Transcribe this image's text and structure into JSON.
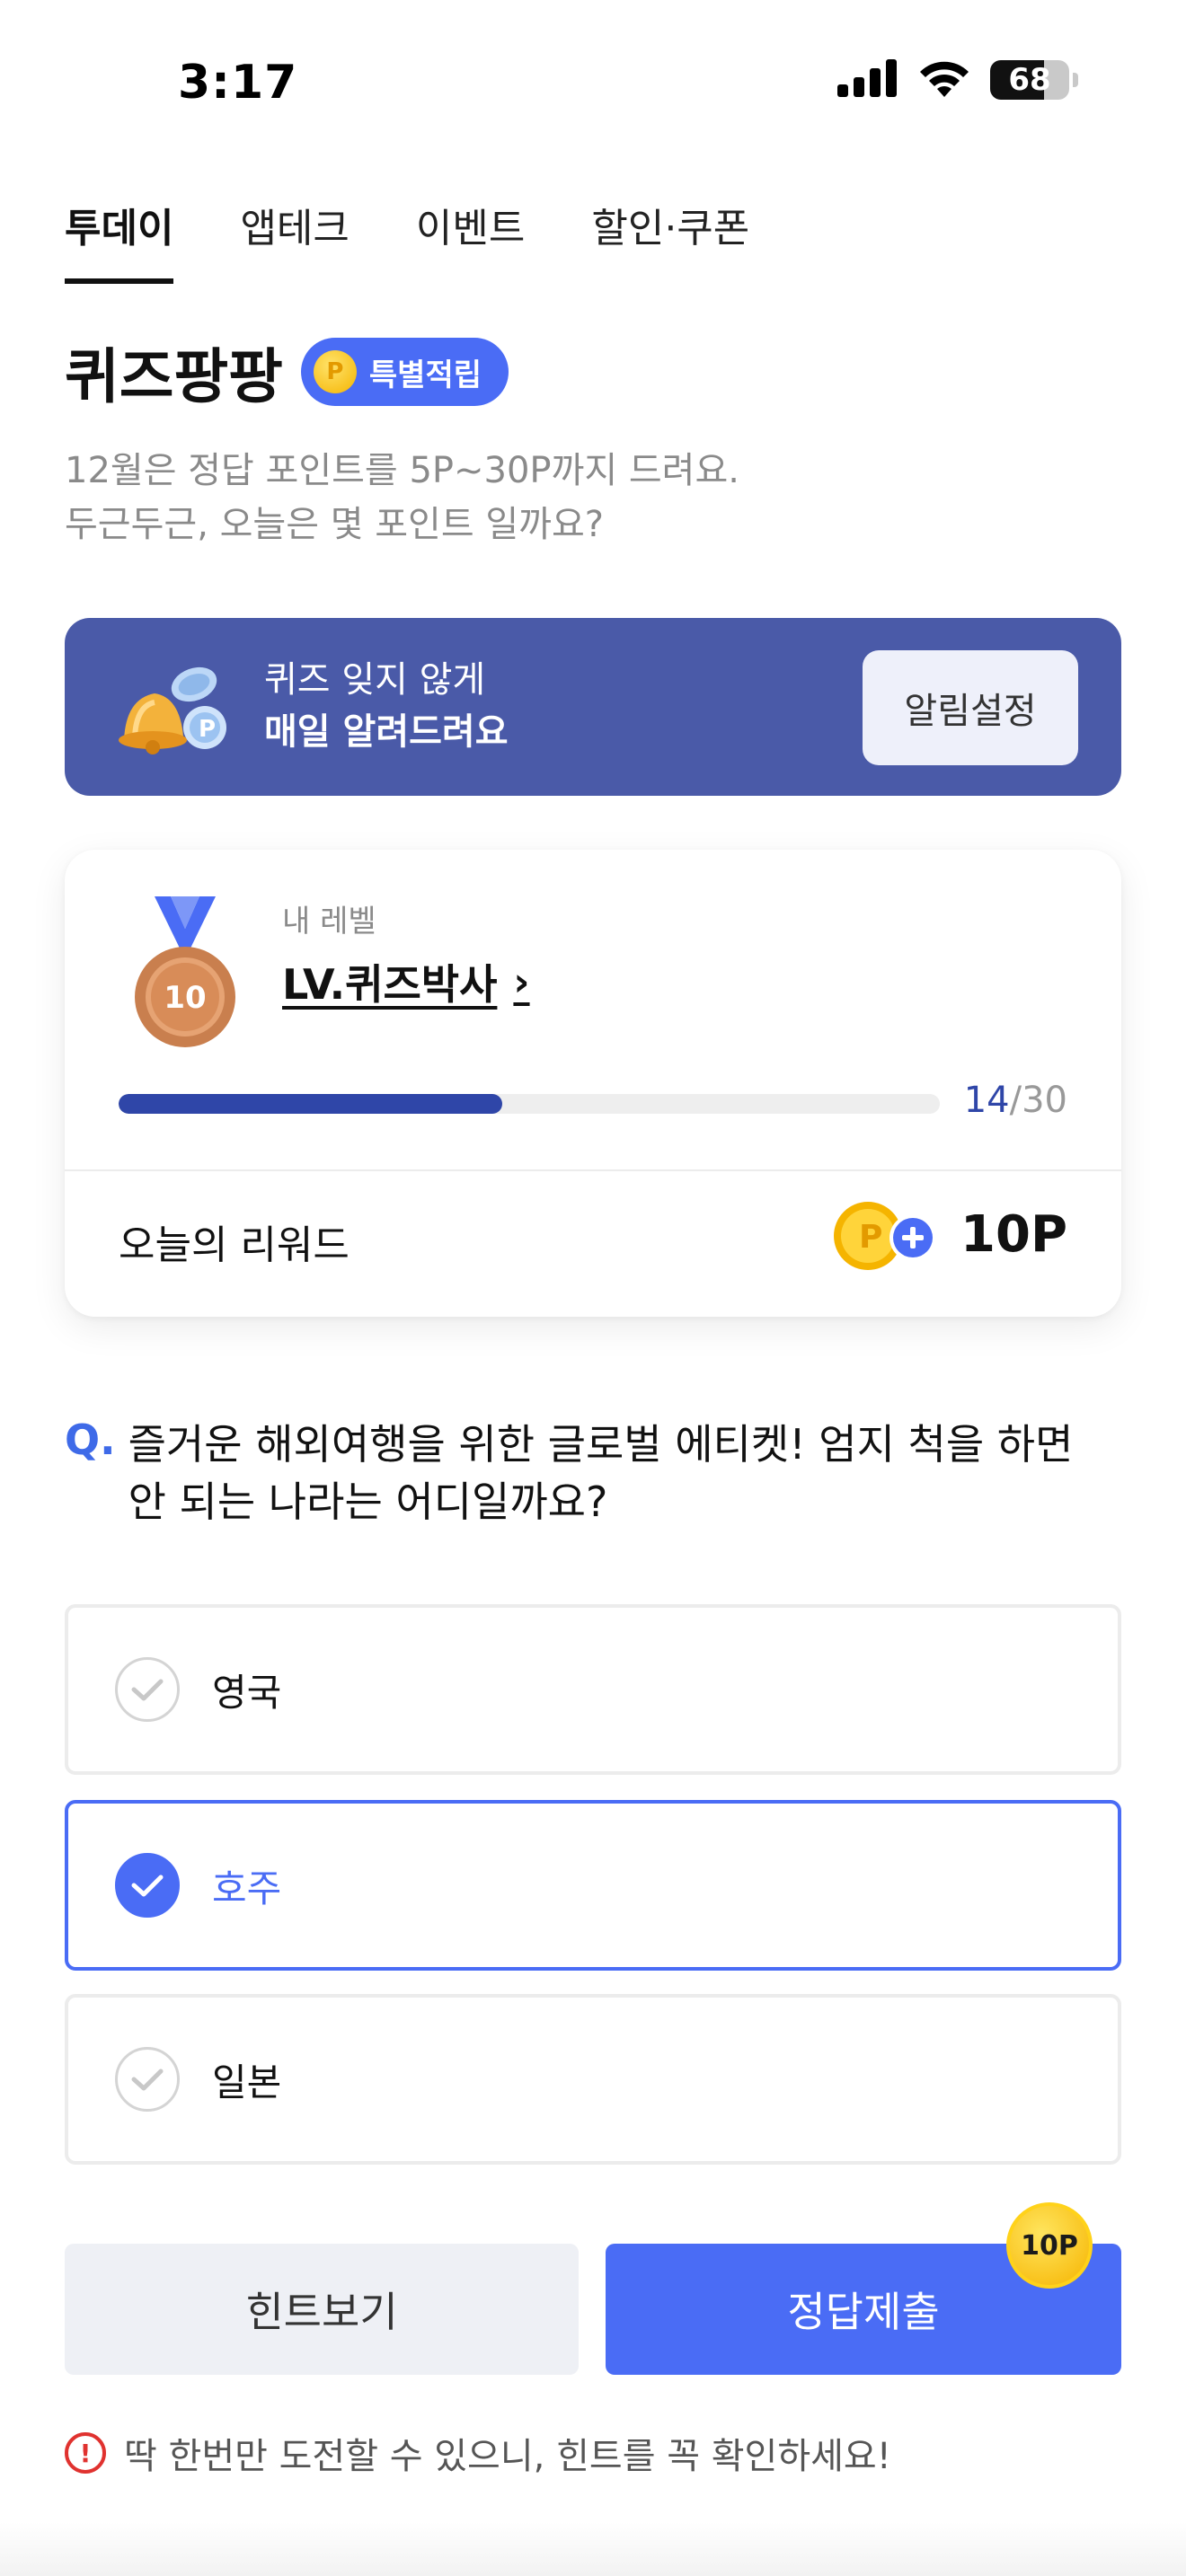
{
  "status_bar": {
    "time": "3:17",
    "battery": "68"
  },
  "tabs": [
    {
      "label": "투데이",
      "active": true
    },
    {
      "label": "앱테크",
      "active": false
    },
    {
      "label": "이벤트",
      "active": false
    },
    {
      "label": "할인·쿠폰",
      "active": false
    }
  ],
  "header": {
    "title": "퀴즈팡팡",
    "badge": "특별적립",
    "subtitle_line1": "12월은 정답 포인트를 5P~30P까지 드려요.",
    "subtitle_line2": "두근두근, 오늘은 몇 포인트 일까요?"
  },
  "notice": {
    "line1": "퀴즈 잊지 않게",
    "line2": "매일 알려드려요",
    "button": "알림설정"
  },
  "level": {
    "caption": "내 레벨",
    "name": "LV.퀴즈박사",
    "medal_number": "10",
    "progress_current": "14",
    "progress_total": "/30",
    "progress_fraction": 0.4667
  },
  "reward": {
    "label": "오늘의 리워드",
    "value": "10P"
  },
  "question": {
    "mark": "Q.",
    "text_line1": "즐거운 해외여행을 위한 글로벌 에티켓! 엄지 척을 하면",
    "text_line2": "안 되는 나라는 어디일까요?"
  },
  "options": [
    {
      "label": "영국",
      "selected": false
    },
    {
      "label": "호주",
      "selected": true
    },
    {
      "label": "일본",
      "selected": false
    }
  ],
  "buttons": {
    "hint": "힌트보기",
    "submit": "정답제출",
    "point_chip": "10P"
  },
  "warning": {
    "text": "딱 한번만 도전할 수 있으니, 힌트를 꼭 확인하세요!"
  },
  "colors": {
    "accent": "#4a6cf5",
    "navy": "#2f46a8",
    "banner": "#4a5aa8",
    "warning": "#e0322f"
  }
}
